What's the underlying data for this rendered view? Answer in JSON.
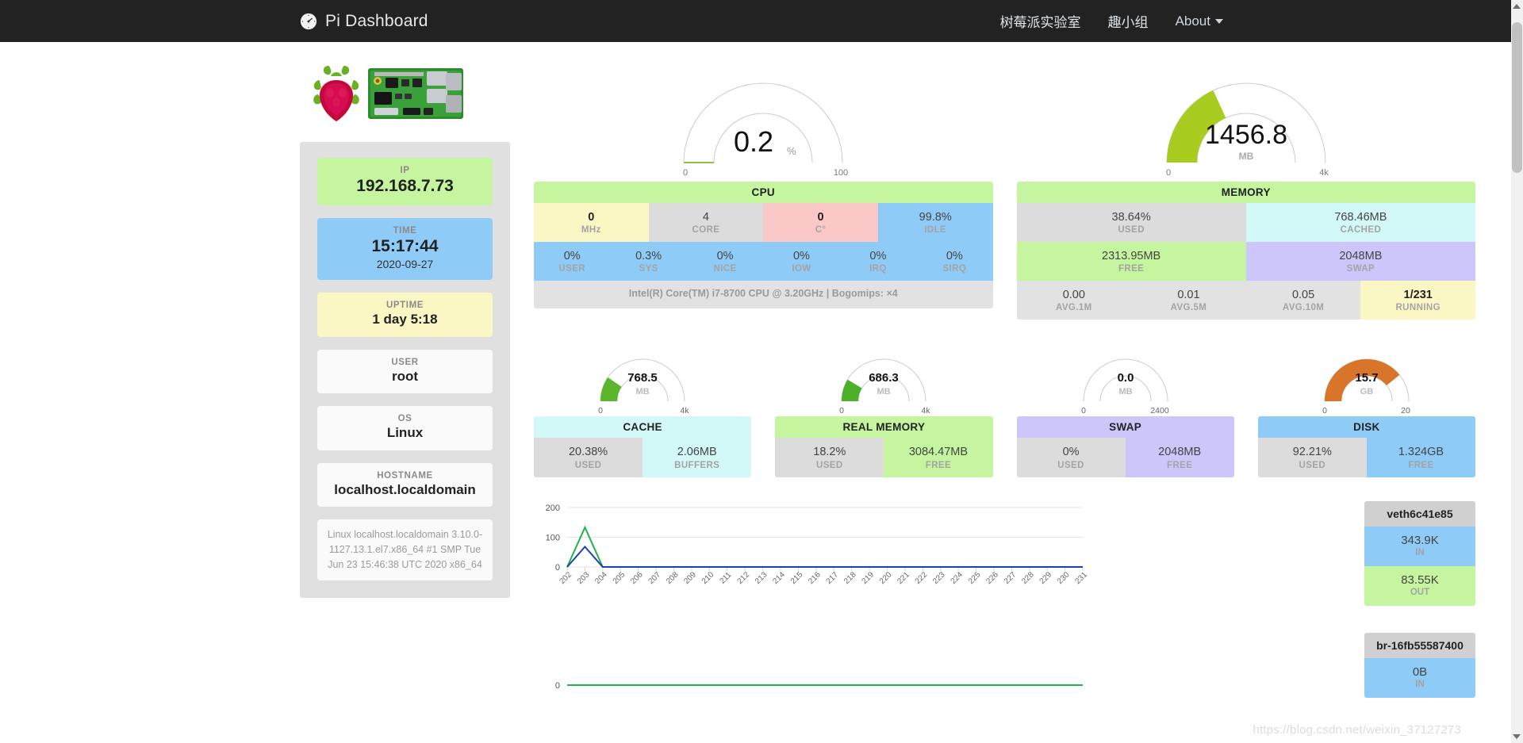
{
  "navbar": {
    "brand": "Pi Dashboard",
    "brand_icon": "gauge-icon",
    "links": [
      {
        "label": "树莓派实验室"
      },
      {
        "label": "趣小组"
      },
      {
        "label": "About"
      }
    ]
  },
  "sidebar": {
    "ip": {
      "label": "IP",
      "value": "192.168.7.73"
    },
    "time": {
      "label": "TIME",
      "value": "15:17:44",
      "date": "2020-09-27"
    },
    "uptime": {
      "label": "UPTIME",
      "value": "1 day 5:18"
    },
    "user": {
      "label": "USER",
      "value": "root"
    },
    "os": {
      "label": "OS",
      "value": "Linux"
    },
    "hostname": {
      "label": "HOSTNAME",
      "value": "localhost.localdomain"
    },
    "kernel": "Linux localhost.localdomain 3.10.0-1127.13.1.el7.x86_64 #1 SMP Tue Jun 23 15:46:38 UTC 2020 x86_64"
  },
  "gauges": {
    "cpu": {
      "value": "0.2",
      "unit": "%",
      "min": "0",
      "max": "100",
      "pct": 0.2,
      "color": "#8cc63f"
    },
    "memory": {
      "value": "1456.8",
      "unit": "MB",
      "min": "0",
      "max": "4k",
      "pct": 36.4,
      "color": "#a8cd20"
    },
    "cache": {
      "value": "768.5",
      "unit": "MB",
      "min": "0",
      "max": "4k",
      "pct": 19.2,
      "color": "#5cb62b"
    },
    "real": {
      "value": "686.3",
      "unit": "MB",
      "min": "0",
      "max": "4k",
      "pct": 17.2,
      "color": "#4cb02a"
    },
    "swap": {
      "value": "0.0",
      "unit": "MB",
      "min": "0",
      "max": "2400",
      "pct": 0,
      "color": "#8cc63f"
    },
    "disk": {
      "value": "15.7",
      "unit": "GB",
      "min": "0",
      "max": "20",
      "pct": 78.5,
      "color": "#d9742b"
    }
  },
  "cpu_panel": {
    "title": "CPU",
    "row1": [
      {
        "value": "0",
        "key": "MHz"
      },
      {
        "value": "4",
        "key": "CORE"
      },
      {
        "value": "0",
        "key": "C°"
      },
      {
        "value": "99.8%",
        "key": "IDLE"
      }
    ],
    "row2": [
      {
        "value": "0%",
        "key": "USER"
      },
      {
        "value": "0.3%",
        "key": "SYS"
      },
      {
        "value": "0%",
        "key": "NICE"
      },
      {
        "value": "0%",
        "key": "IOW"
      },
      {
        "value": "0%",
        "key": "IRQ"
      },
      {
        "value": "0%",
        "key": "SIRQ"
      }
    ],
    "footer": "Intel(R) Core(TM) i7-8700 CPU @ 3.20GHz | Bogomips: ×4"
  },
  "memory_panel": {
    "title": "MEMORY",
    "row1": [
      {
        "value": "38.64%",
        "key": "USED"
      },
      {
        "value": "768.46MB",
        "key": "CACHED"
      }
    ],
    "row2": [
      {
        "value": "2313.95MB",
        "key": "FREE"
      },
      {
        "value": "2048MB",
        "key": "SWAP"
      }
    ],
    "row3": [
      {
        "value": "0.00",
        "key": "AVG.1M"
      },
      {
        "value": "0.01",
        "key": "AVG.5M"
      },
      {
        "value": "0.05",
        "key": "AVG.10M"
      },
      {
        "value": "1/231",
        "key": "RUNNING"
      }
    ]
  },
  "small_panels": [
    {
      "title": "CACHE",
      "cells": [
        {
          "value": "20.38%",
          "key": "USED"
        },
        {
          "value": "2.06MB",
          "key": "BUFFERS"
        }
      ]
    },
    {
      "title": "REAL MEMORY",
      "cells": [
        {
          "value": "18.2%",
          "key": "USED"
        },
        {
          "value": "3084.47MB",
          "key": "FREE"
        }
      ]
    },
    {
      "title": "SWAP",
      "cells": [
        {
          "value": "0%",
          "key": "USED"
        },
        {
          "value": "2048MB",
          "key": "FREE"
        }
      ]
    },
    {
      "title": "DISK",
      "cells": [
        {
          "value": "92.21%",
          "key": "USED"
        },
        {
          "value": "1.324GB",
          "key": "FREE"
        }
      ]
    }
  ],
  "network": [
    {
      "name": "veth6c41e85",
      "in": {
        "value": "343.9K",
        "key": "IN"
      },
      "out": {
        "value": "83.55K",
        "key": "OUT"
      }
    },
    {
      "name": "br-16fb55587400",
      "in": {
        "value": "0B",
        "key": "IN"
      }
    }
  ],
  "chart_data": [
    {
      "type": "line",
      "title": "",
      "xlabel": "",
      "ylabel": "",
      "x": [
        "202",
        "203",
        "204",
        "205",
        "206",
        "207",
        "208",
        "209",
        "210",
        "211",
        "212",
        "213",
        "214",
        "215",
        "216",
        "217",
        "218",
        "219",
        "220",
        "221",
        "222",
        "223",
        "224",
        "225",
        "226",
        "227",
        "228",
        "229",
        "230",
        "231"
      ],
      "ylim": [
        0,
        200
      ],
      "yticks": [
        0,
        100,
        200
      ],
      "grid": true,
      "legend": "none",
      "series": [
        {
          "name": "IN",
          "color": "#22b14c",
          "values": [
            0,
            133,
            0,
            0,
            0,
            0,
            0,
            0,
            0,
            0,
            0,
            0,
            0,
            0,
            0,
            0,
            0,
            0,
            0,
            0,
            0,
            0,
            0,
            0,
            0,
            0,
            0,
            0,
            0,
            0
          ]
        },
        {
          "name": "OUT",
          "color": "#1f3fb5",
          "values": [
            0,
            68,
            0,
            0,
            0,
            0,
            0,
            0,
            0,
            0,
            0,
            0,
            0,
            0,
            0,
            0,
            0,
            0,
            0,
            0,
            0,
            0,
            0,
            0,
            0,
            0,
            0,
            0,
            0,
            0
          ]
        }
      ]
    },
    {
      "type": "line",
      "title": "",
      "xlabel": "",
      "ylabel": "",
      "x": [
        "202",
        "203",
        "204",
        "205",
        "206",
        "207",
        "208",
        "209",
        "210",
        "211",
        "212",
        "213",
        "214",
        "215",
        "216",
        "217",
        "218",
        "219",
        "220",
        "221",
        "222",
        "223",
        "224",
        "225",
        "226",
        "227",
        "228",
        "229",
        "230",
        "231"
      ],
      "ylim": [
        0,
        1
      ],
      "yticks": [
        0
      ],
      "grid": false,
      "legend": "none",
      "series": [
        {
          "name": "IN",
          "color": "#22b14c",
          "values": [
            0,
            0,
            0,
            0,
            0,
            0,
            0,
            0,
            0,
            0,
            0,
            0,
            0,
            0,
            0,
            0,
            0,
            0,
            0,
            0,
            0,
            0,
            0,
            0,
            0,
            0,
            0,
            0,
            0,
            0
          ]
        }
      ]
    }
  ],
  "watermark": "https://blog.csdn.net/weixin_37127273"
}
